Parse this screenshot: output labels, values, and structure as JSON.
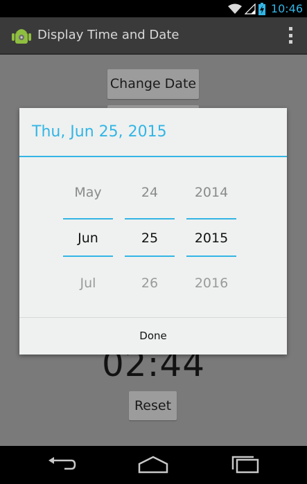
{
  "status_bar": {
    "time": "10:46"
  },
  "action_bar": {
    "title": "Display Time and Date"
  },
  "content": {
    "change_date_label": "Change Date",
    "clock": "02:44",
    "reset_label": "Reset"
  },
  "dialog": {
    "title": "Thu, Jun 25, 2015",
    "month": {
      "prev": "May",
      "current": "Jun",
      "next": "Jul"
    },
    "day": {
      "prev": "24",
      "current": "25",
      "next": "26"
    },
    "year": {
      "prev": "2014",
      "current": "2015",
      "next": "2016"
    },
    "done_label": "Done"
  },
  "colors": {
    "accent": "#33b5e5",
    "dialog_bg": "#eef1f0",
    "dim_bg": "#7a7a7a"
  },
  "icons": [
    "wifi-icon",
    "signal-icon",
    "battery-charging-icon",
    "android-app-icon",
    "overflow-menu-icon",
    "back-icon",
    "home-icon",
    "recents-icon"
  ]
}
